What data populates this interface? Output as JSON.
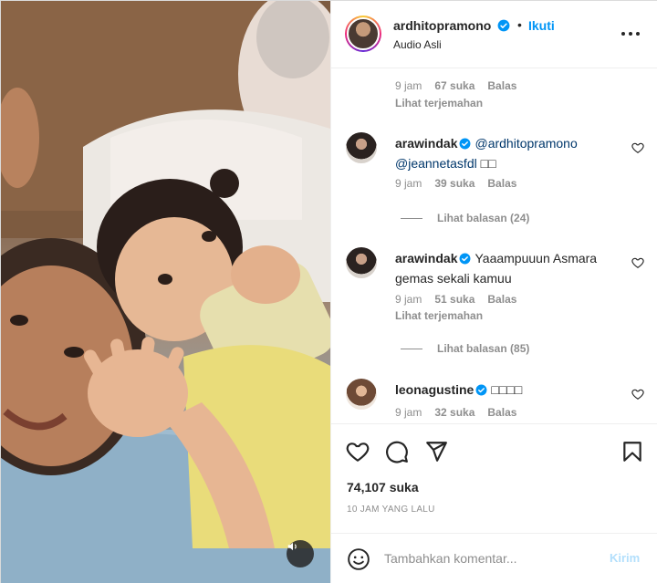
{
  "post": {
    "username": "ardhitopramono",
    "follow_label": "Ikuti",
    "dot": "•",
    "audio": "Audio Asli",
    "more_label": "•••"
  },
  "comments": {
    "first_meta": {
      "time": "9 jam",
      "likes": "67 suka",
      "reply": "Balas",
      "translate": "Lihat terjemahan"
    },
    "items": [
      {
        "username": "arawindak",
        "mention1": "@ardhitopramono",
        "mention2": "@jeannetasfdl",
        "trail": "□□",
        "time": "9 jam",
        "likes": "39 suka",
        "reply": "Balas",
        "view_replies": "Lihat balasan (24)"
      },
      {
        "username": "arawindak",
        "text": "Yaaampuuun Asmara gemas sekali kamuu",
        "time": "9 jam",
        "likes": "51 suka",
        "reply": "Balas",
        "translate": "Lihat terjemahan",
        "view_replies": "Lihat balasan (85)"
      },
      {
        "username": "leonagustine",
        "text": "□□□□",
        "time": "9 jam",
        "likes": "32 suka",
        "reply": "Balas"
      }
    ]
  },
  "actions": {
    "likes": "74,107 suka",
    "time_ago": "10 JAM YANG LALU"
  },
  "add_comment": {
    "placeholder": "Tambahkan komentar...",
    "post_label": "Kirim"
  },
  "icons": {
    "verified": "verified-badge-icon",
    "more": "more-options-icon",
    "heart": "heart-icon",
    "comment": "comment-icon",
    "share": "share-icon",
    "save": "save-icon",
    "emoji": "emoji-icon",
    "sound": "speaker-icon"
  },
  "colors": {
    "accent": "#0095f6",
    "text": "#262626",
    "secondary": "#8e8e8e",
    "post_disabled": "#b2dffc"
  }
}
